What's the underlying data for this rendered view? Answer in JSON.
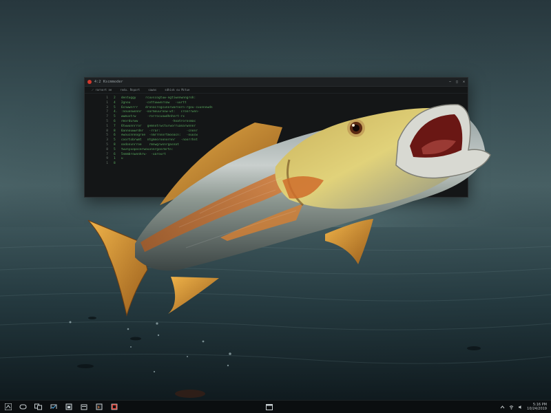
{
  "terminal": {
    "title": "4:2 Kscmmoder",
    "controls": [
      "—",
      "□",
      "✕"
    ],
    "menu": [
      "⟋ rarnort ǝe",
      "rodu. Ropart",
      "sawas",
      "sdhivk ou Mctue"
    ],
    "lines": [
      {
        "num": "1",
        "text": "2   dentuggy     rcuvscogtuw-ngtiwenwnngroh:"
      },
      {
        "num": "1",
        "text": "4   2gnou        ·cottuwwnrnaw   ·uurtt"
      },
      {
        "num": "3",
        "text": "5   6cnwwnrrr    dronacrogcunorwarnorn·rgou·cuunnowdn"
      },
      {
        "num": "7",
        "text": "4.  :nouonwonnr  ·oarmouuroow·wt:   cronrrwnn·"
      },
      {
        "num": "7",
        "text": "5   wwmuvtrw      ·rorrocuowdhnhnrt·rx"
      },
      {
        "num": "5",
        "text": "6   rmordurww                  ·hoatrorosmac"
      },
      {
        "num": "1",
        "text": "7   6twwunnrror   gemnotrwcturworruanarwnnnr"
      },
      {
        "num": "8",
        "text": "8   6annouwwrdnr   ·rrar:              ·cnonr"
      },
      {
        "num": "5",
        "text": "6   ewoucnnnogroe  ·nmrrnnortmooacn:   ·ouucw"
      },
      {
        "num": "3",
        "text": "5   coortobrwmt   ntgmnoroonornnr   ·noorrhnt"
      },
      {
        "num": "5",
        "text": "8   oodonvnrroe    rmnwgrwsnrgasnat"
      },
      {
        "num": "8",
        "text": "5   twvnyxopocerwouvnnrgonrmrtn:"
      },
      {
        "num": "7",
        "text": "6   5nmmbrowonkrw·  ·uarourt"
      },
      {
        "num": "9",
        "text": "1   u"
      },
      {
        "num": "1",
        "text": "8"
      }
    ]
  },
  "taskbar": {
    "buttons": [
      {
        "name": "start-button",
        "icon": "start-icon"
      },
      {
        "name": "search-button",
        "icon": "search-icon"
      },
      {
        "name": "task-view-button",
        "icon": "task-view-icon"
      },
      {
        "name": "edge-button",
        "icon": "browser-icon"
      },
      {
        "name": "explorer-button",
        "icon": "folder-icon"
      },
      {
        "name": "store-button",
        "icon": "store-icon"
      },
      {
        "name": "terminal-button",
        "icon": "terminal-icon"
      },
      {
        "name": "app-button",
        "icon": "app-icon"
      }
    ],
    "center_app_icon": "window-icon",
    "clock": {
      "time": "5:16 PM",
      "date": "10/24/2019"
    },
    "tray_icons": [
      "chevron-up-icon",
      "wifi-icon",
      "volume-icon"
    ]
  },
  "colors": {
    "accent": "#d2392e",
    "code_green": "#59a95e",
    "taskbar": "#0b0e10"
  }
}
